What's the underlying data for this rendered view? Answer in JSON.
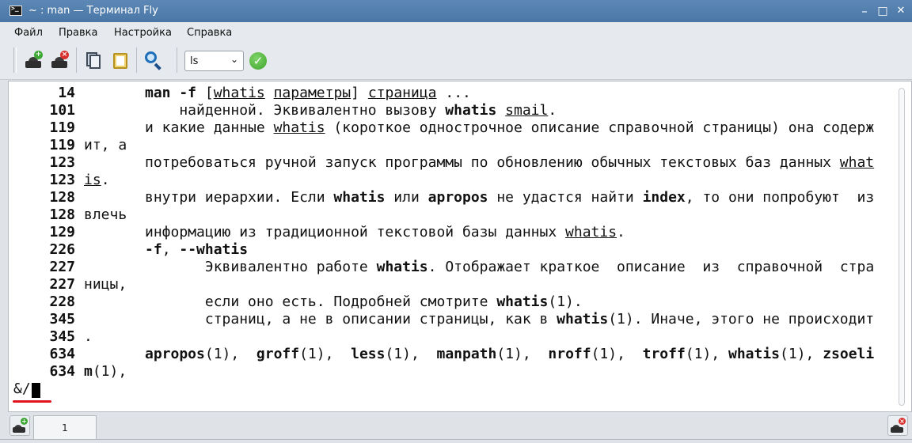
{
  "window": {
    "title": "~ : man — Терминал Fly"
  },
  "titlebar_buttons": {
    "minimize": "–",
    "maximize": "□",
    "close": "✕"
  },
  "menu": [
    "Файл",
    "Правка",
    "Настройка",
    "Справка"
  ],
  "toolbar": {
    "command_select_value": "ls",
    "icons": [
      "new-session-icon",
      "close-session-icon",
      "copy-icon",
      "paste-icon",
      "search-icon",
      "apply-icon"
    ]
  },
  "terminal": {
    "lines": [
      {
        "num": "14",
        "cont": [],
        "text": [
          {
            "t": "man -f",
            "s": "b"
          },
          {
            "t": " ["
          },
          {
            "t": "whatis",
            "s": "u"
          },
          {
            "t": " "
          },
          {
            "t": "параметры",
            "s": "u"
          },
          {
            "t": "] "
          },
          {
            "t": "страница",
            "s": "u"
          },
          {
            "t": " ..."
          }
        ]
      },
      {
        "num": "101",
        "cont": [],
        "text": [
          {
            "t": "    найденной. Эквивалентно вызову "
          },
          {
            "t": "whatis",
            "s": "b"
          },
          {
            "t": " "
          },
          {
            "t": "smail",
            "s": "u"
          },
          {
            "t": "."
          }
        ]
      },
      {
        "num": "119",
        "cont": [],
        "text": [
          {
            "t": "и какие данные "
          },
          {
            "t": "whatis",
            "s": "u"
          },
          {
            "t": " (короткое однострочное описание справочной страницы) она содерж"
          }
        ]
      },
      {
        "num": "119",
        "cont": [
          {
            "t": "ит, а"
          }
        ],
        "text": []
      },
      {
        "num": "123",
        "cont": [],
        "text": [
          {
            "t": "потребоваться ручной запуск программы по обновлению обычных текстовых баз данных "
          },
          {
            "t": "what",
            "s": "u"
          }
        ]
      },
      {
        "num": "123",
        "cont": [
          {
            "t": "is",
            "s": "u"
          },
          {
            "t": "."
          }
        ],
        "text": []
      },
      {
        "num": "128",
        "cont": [],
        "text": [
          {
            "t": "внутри иерархии. Если "
          },
          {
            "t": "whatis",
            "s": "b"
          },
          {
            "t": " или "
          },
          {
            "t": "apropos",
            "s": "b"
          },
          {
            "t": " не удастся найти "
          },
          {
            "t": "index",
            "s": "b"
          },
          {
            "t": ", то они попробуют  из"
          }
        ]
      },
      {
        "num": "128",
        "cont": [
          {
            "t": "влечь"
          }
        ],
        "text": []
      },
      {
        "num": "129",
        "cont": [],
        "text": [
          {
            "t": "информацию из традиционной текстовой базы данных "
          },
          {
            "t": "whatis",
            "s": "u"
          },
          {
            "t": "."
          }
        ]
      },
      {
        "num": "226",
        "cont": [],
        "text": [
          {
            "t": "-f",
            "s": "b"
          },
          {
            "t": ", "
          },
          {
            "t": "--whatis",
            "s": "b"
          }
        ]
      },
      {
        "num": "227",
        "cont": [],
        "text": [
          {
            "t": "       Эквивалентно работе "
          },
          {
            "t": "whatis",
            "s": "b"
          },
          {
            "t": ". Отображает краткое  описание  из  справочной  стра"
          }
        ]
      },
      {
        "num": "227",
        "cont": [
          {
            "t": "ницы,"
          }
        ],
        "text": []
      },
      {
        "num": "228",
        "cont": [],
        "text": [
          {
            "t": "       если оно есть. Подробней смотрите "
          },
          {
            "t": "whatis",
            "s": "b"
          },
          {
            "t": "(1)."
          }
        ]
      },
      {
        "num": "345",
        "cont": [],
        "text": [
          {
            "t": "       страниц, а не в описании страницы, как в "
          },
          {
            "t": "whatis",
            "s": "b"
          },
          {
            "t": "(1). Иначе, этого не происходит"
          }
        ]
      },
      {
        "num": "345",
        "cont": [
          {
            "t": "."
          }
        ],
        "text": []
      },
      {
        "num": "634",
        "cont": [],
        "text": [
          {
            "t": "apropos",
            "s": "b"
          },
          {
            "t": "(1),  "
          },
          {
            "t": "groff",
            "s": "b"
          },
          {
            "t": "(1),  "
          },
          {
            "t": "less",
            "s": "b"
          },
          {
            "t": "(1),  "
          },
          {
            "t": "manpath",
            "s": "b"
          },
          {
            "t": "(1),  "
          },
          {
            "t": "nroff",
            "s": "b"
          },
          {
            "t": "(1),  "
          },
          {
            "t": "troff",
            "s": "b"
          },
          {
            "t": "(1), "
          },
          {
            "t": "whatis",
            "s": "b"
          },
          {
            "t": "(1), "
          },
          {
            "t": "zsoeli",
            "s": "b"
          }
        ]
      },
      {
        "num": "634",
        "cont": [
          {
            "t": "m",
            "s": "b"
          },
          {
            "t": "(1),"
          }
        ],
        "text": []
      }
    ],
    "prompt": "&/"
  },
  "bottom": {
    "tab_label": "1"
  },
  "colors": {
    "titlebar": "#4a77a6",
    "accent_underline": "#e0141a"
  }
}
